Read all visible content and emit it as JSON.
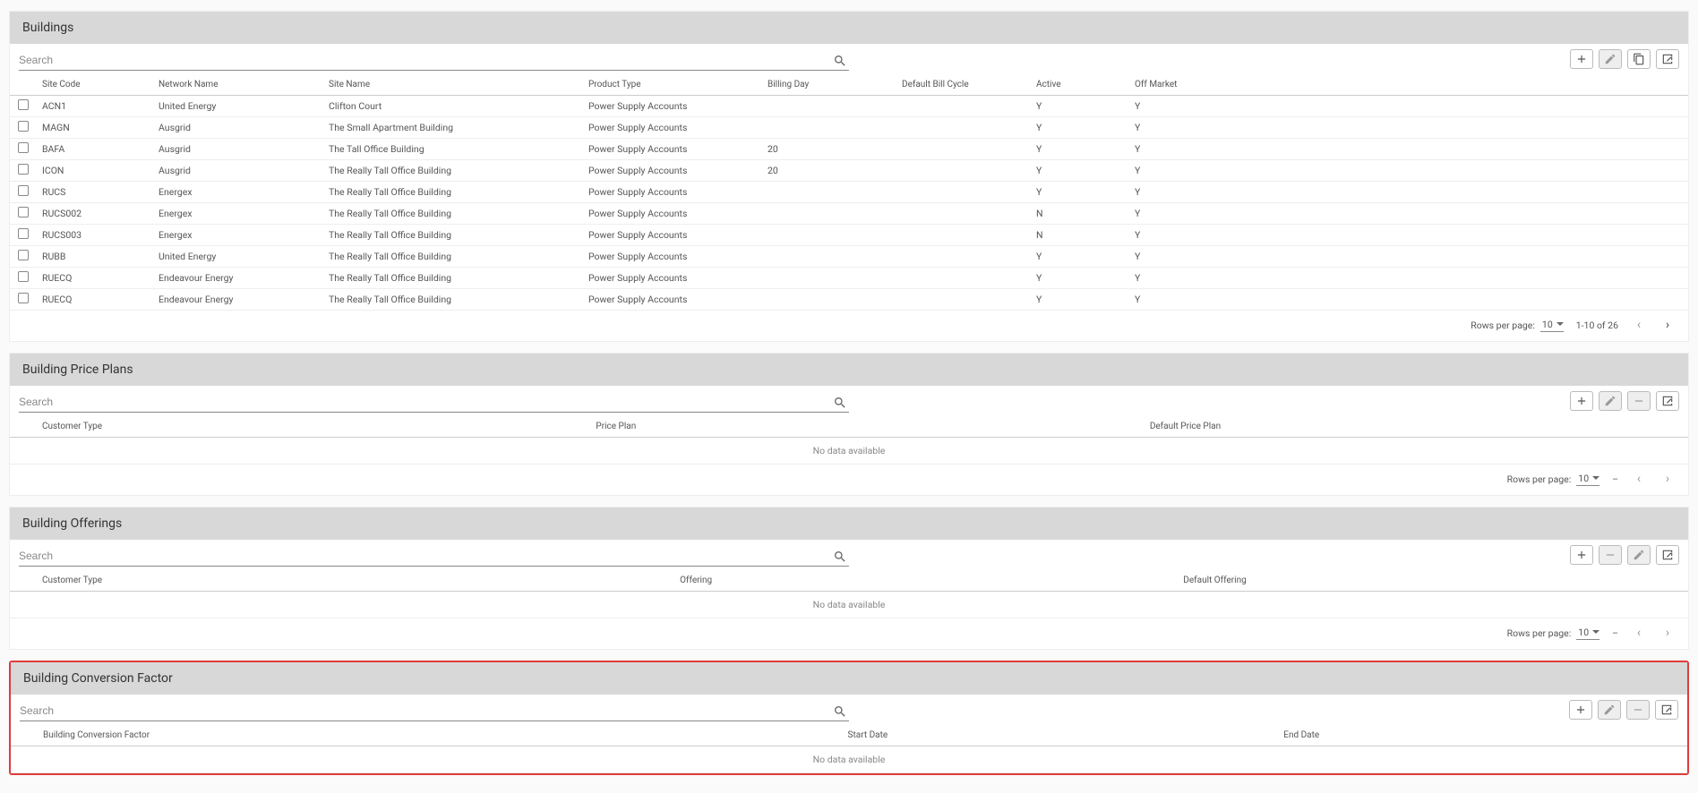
{
  "common": {
    "search_placeholder": "Search",
    "no_data": "No data available",
    "rows_per_page_label": "Rows per page:",
    "rows_per_page_value": "10"
  },
  "buildings": {
    "title": "Buildings",
    "pager_range": "1-10 of 26",
    "columns": [
      "Site Code",
      "Network Name",
      "Site Name",
      "Product Type",
      "Billing Day",
      "Default Bill Cycle",
      "Active",
      "Off Market"
    ],
    "rows": [
      {
        "site": "ACN1",
        "net": "United Energy",
        "name": "Clifton Court",
        "prod": "Power Supply Accounts",
        "bill": "",
        "def": "",
        "active": "Y",
        "off": "Y"
      },
      {
        "site": "MAGN",
        "net": "Ausgrid",
        "name": "The Small Apartment Building",
        "prod": "Power Supply Accounts",
        "bill": "",
        "def": "",
        "active": "Y",
        "off": "Y"
      },
      {
        "site": "BAFA",
        "net": "Ausgrid",
        "name": "The Tall Office Building",
        "prod": "Power Supply Accounts",
        "bill": "20",
        "def": "",
        "active": "Y",
        "off": "Y"
      },
      {
        "site": "ICON",
        "net": "Ausgrid",
        "name": "The Really Tall Office Building",
        "prod": "Power Supply Accounts",
        "bill": "20",
        "def": "",
        "active": "Y",
        "off": "Y"
      },
      {
        "site": "RUCS",
        "net": "Energex",
        "name": "The Really Tall Office Building",
        "prod": "Power Supply Accounts",
        "bill": "",
        "def": "",
        "active": "Y",
        "off": "Y"
      },
      {
        "site": "RUCS002",
        "net": "Energex",
        "name": "The Really Tall Office Building",
        "prod": "Power Supply Accounts",
        "bill": "",
        "def": "",
        "active": "N",
        "off": "Y"
      },
      {
        "site": "RUCS003",
        "net": "Energex",
        "name": "The Really Tall Office Building",
        "prod": "Power Supply Accounts",
        "bill": "",
        "def": "",
        "active": "N",
        "off": "Y"
      },
      {
        "site": "RUBB",
        "net": "United Energy",
        "name": "The Really Tall Office Building",
        "prod": "Power Supply Accounts",
        "bill": "",
        "def": "",
        "active": "Y",
        "off": "Y"
      },
      {
        "site": "RUECQ",
        "net": "Endeavour Energy",
        "name": "The Really Tall Office Building",
        "prod": "Power Supply Accounts",
        "bill": "",
        "def": "",
        "active": "Y",
        "off": "Y"
      },
      {
        "site": "RUECQ",
        "net": "Endeavour Energy",
        "name": "The Really Tall Office Building",
        "prod": "Power Supply Accounts",
        "bill": "",
        "def": "",
        "active": "Y",
        "off": "Y"
      }
    ]
  },
  "price_plans": {
    "title": "Building Price Plans",
    "columns": [
      "Customer Type",
      "Price Plan",
      "Default Price Plan"
    ],
    "pager_range": "–"
  },
  "offerings": {
    "title": "Building Offerings",
    "columns": [
      "Customer Type",
      "Offering",
      "Default Offering"
    ],
    "pager_range": "–"
  },
  "conversion": {
    "title": "Building Conversion Factor",
    "columns": [
      "Building Conversion Factor",
      "Start Date",
      "End Date"
    ]
  }
}
